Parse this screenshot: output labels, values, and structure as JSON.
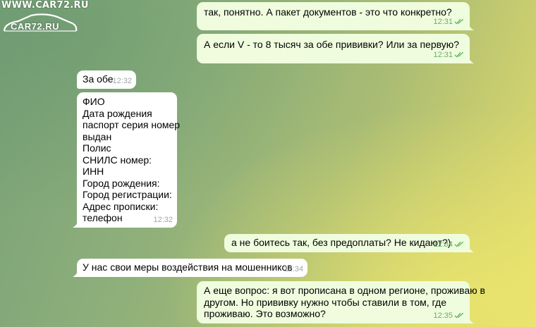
{
  "watermark": {
    "top": "WWW.CAR72.RU",
    "logo": "CAR72.RU"
  },
  "messages": [
    {
      "dir": "out",
      "lines": [
        "так, понятно. А пакет документов - это что конкретно?"
      ],
      "time": "12:31",
      "status": "read-check-icon"
    },
    {
      "dir": "out",
      "lines": [
        "А если V - то 8 тысяч за обе прививки? Или за первую?"
      ],
      "time": "12:31",
      "status": "read-check-icon"
    },
    {
      "dir": "in",
      "lines": [
        "За обе"
      ],
      "time": "12:32"
    },
    {
      "dir": "in",
      "lines": [
        "ФИО",
        "Дата рождения",
        "паспорт серия номер",
        "выдан",
        "Полис",
        "СНИЛС номер:",
        "ИНН",
        "Город рождения:",
        "Город регистрации:",
        "Адрес прописки:",
        "телефон"
      ],
      "time": "12:32"
    },
    {
      "dir": "out",
      "lines": [
        "а не боитесь так, без предоплаты? Не кидают?)"
      ],
      "time": "12:34",
      "status": "read-check-icon"
    },
    {
      "dir": "in",
      "lines": [
        "У нас свои меры воздействия на мошенников"
      ],
      "time": "12:34"
    },
    {
      "dir": "out",
      "lines": [
        "А еще вопрос: я вот прописана в одном регионе, проживаю в",
        "другом. Но прививку нужно чтобы ставили в том, где",
        "проживаю. Это возможно?"
      ],
      "time": "12:35",
      "status": "read-check-icon"
    }
  ]
}
